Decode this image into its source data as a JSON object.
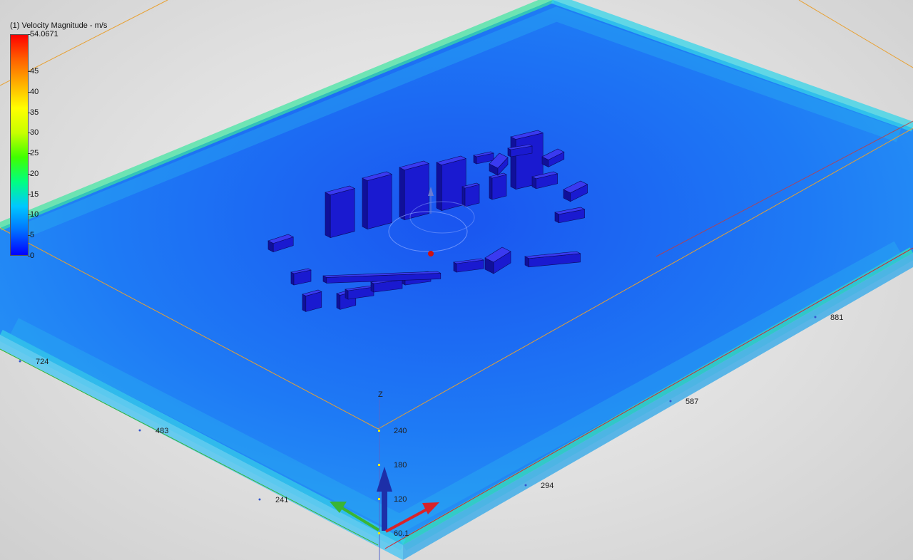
{
  "legend": {
    "title": "(1) Velocity Magnitude - m/s",
    "max_label": "54.0671",
    "ticks": [
      "45",
      "40",
      "35",
      "30",
      "25",
      "20",
      "15",
      "10",
      "5",
      "0"
    ],
    "tick_values": [
      45,
      40,
      35,
      30,
      25,
      20,
      15,
      10,
      5,
      0
    ],
    "max_value": 54.0671,
    "colors": [
      "#0000ff",
      "#0070ff",
      "#00c8ff",
      "#00ff80",
      "#40ff00",
      "#c8ff00",
      "#ffff00",
      "#ffb000",
      "#ff6000",
      "#ff0000"
    ]
  },
  "axes": {
    "z_label": "Z",
    "z_ticks": [
      "240",
      "180",
      "120",
      "60.1"
    ],
    "x_ticks": [
      "294",
      "587",
      "881"
    ],
    "y_ticks": [
      "241",
      "483",
      "724"
    ]
  },
  "colors": {
    "domain_fill": "#1f7cff",
    "domain_edge": "#1fd8e8",
    "building": "#1414d8",
    "axis_x": "#d8232a",
    "axis_y": "#3ab534",
    "axis_z": "#1d2fa8",
    "bbox_orange": "#e8a030"
  }
}
